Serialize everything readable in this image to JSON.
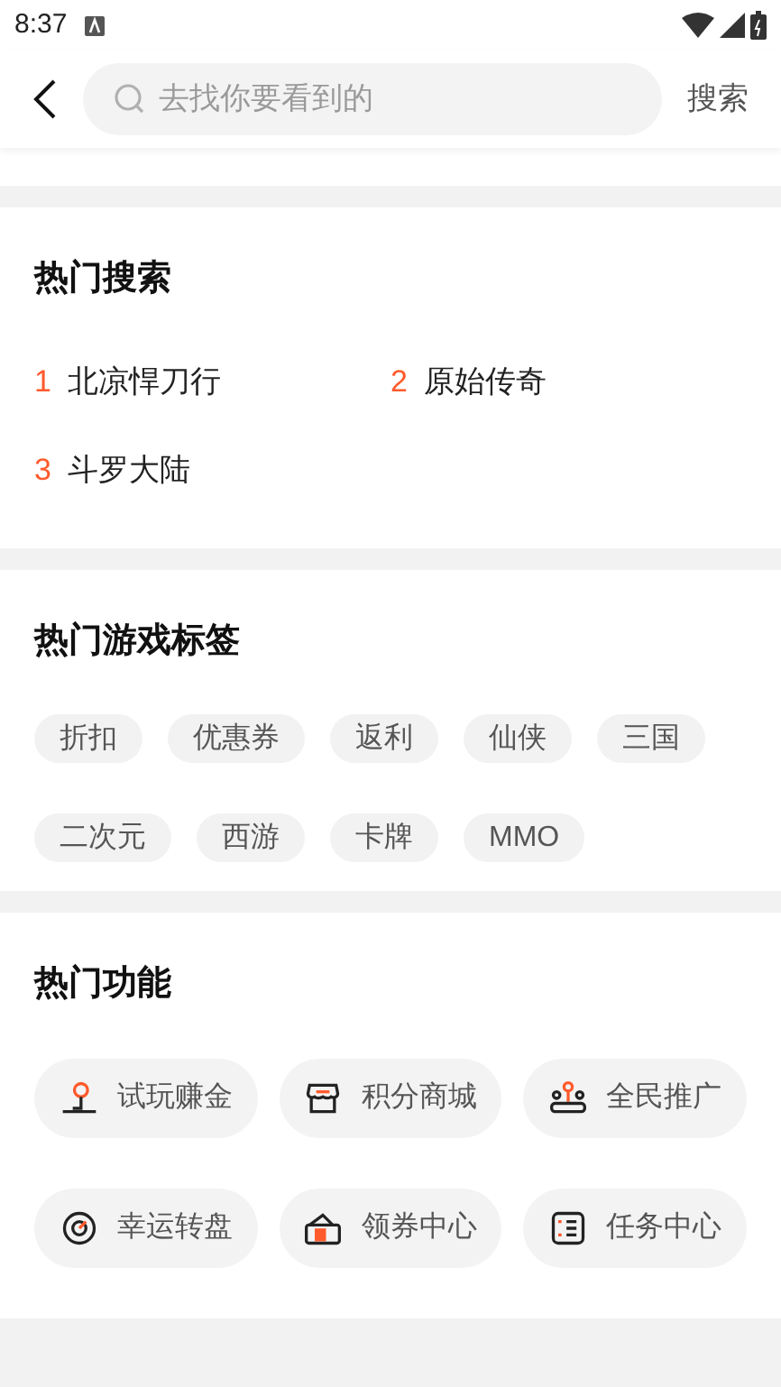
{
  "status_bar": {
    "time": "8:37"
  },
  "search": {
    "placeholder": "去找你要看到的",
    "button": "搜索"
  },
  "hot_search": {
    "title": "热门搜索",
    "items": [
      {
        "rank": "1",
        "label": "北凉悍刀行"
      },
      {
        "rank": "2",
        "label": "原始传奇"
      },
      {
        "rank": "3",
        "label": "斗罗大陆"
      }
    ]
  },
  "hot_tags": {
    "title": "热门游戏标签",
    "tags": [
      "折扣",
      "优惠券",
      "返利",
      "仙侠",
      "三国",
      "二次元",
      "西游",
      "卡牌",
      "MMO"
    ]
  },
  "hot_features": {
    "title": "热门功能",
    "items": [
      {
        "kind": "joystick",
        "label": "试玩赚金"
      },
      {
        "kind": "store",
        "label": "积分商城"
      },
      {
        "kind": "people",
        "label": "全民推广"
      },
      {
        "kind": "wheel",
        "label": "幸运转盘"
      },
      {
        "kind": "coupon",
        "label": "领券中心"
      },
      {
        "kind": "checklist",
        "label": "任务中心"
      }
    ]
  }
}
